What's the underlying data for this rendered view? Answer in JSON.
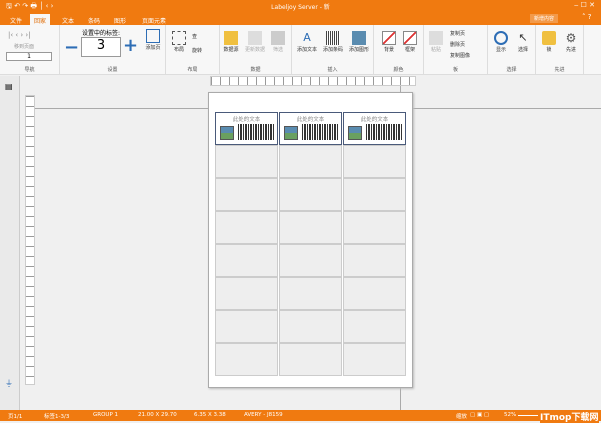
{
  "title": "Labeljoy Server - 新",
  "tabs": [
    "文件",
    "回家",
    "文本",
    "条码",
    "图形",
    "页面元素"
  ],
  "header_button": "新增内容",
  "ribbon": {
    "nav": {
      "label": "导航",
      "page_label": "移到页面",
      "page_value": "1"
    },
    "settings": {
      "label": "设置",
      "selected_label": "设置中的标签:",
      "selected_value": "3",
      "add_page": "添加页"
    },
    "layout": {
      "label": "布局",
      "layout": "布局",
      "edit": "查",
      "rotate": "旋转"
    },
    "data": {
      "label": "数据",
      "source": "数据源",
      "update": "更新数据",
      "filter": "筛选"
    },
    "insert": {
      "label": "插入",
      "add_text": "添加文本",
      "add_barcode": "添加条码",
      "add_image": "添加图形"
    },
    "color": {
      "label": "颜色",
      "background": "背景",
      "border": "框架"
    },
    "board": {
      "label": "板",
      "paste": "粘贴",
      "copy_page": "复制页",
      "delete_page": "删除页",
      "copy_image": "复制图像"
    },
    "select": {
      "label": "选择",
      "show": "显示",
      "select": "选择"
    },
    "advanced": {
      "label": "先进",
      "lock": "锁",
      "advanced": "先进"
    }
  },
  "label_text": "此处的文本",
  "status": {
    "page": "页1/1",
    "labels": "标签1-3/3",
    "group": "GROUP 1",
    "paper": "21.00 X 29.70",
    "label_size": "6.35 X 3.38",
    "template": "AVERY - J8159",
    "zoom_label": "缩放",
    "zoom": "52%",
    "watermark": "ITmop下载网"
  },
  "colors": {
    "accent": "#f07a10"
  }
}
